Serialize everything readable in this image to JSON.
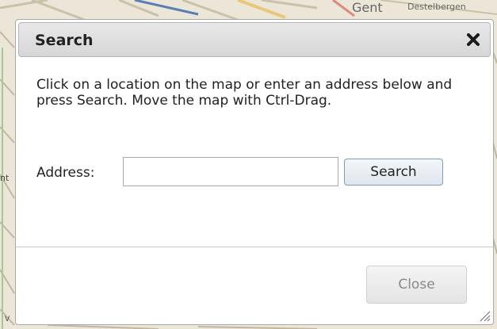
{
  "map": {
    "labels": {
      "gent": "Gent",
      "destelbergen": "Destelbergen",
      "nt": "nt",
      "v": "V"
    }
  },
  "dialog": {
    "title": "Search",
    "close_icon": "close-x-icon",
    "instructions": "Click on a location on the map or enter an address below and press Search. Move the map with Ctrl-Drag.",
    "address_label": "Address:",
    "address_value": "",
    "search_button": "Search",
    "close_button": "Close"
  }
}
